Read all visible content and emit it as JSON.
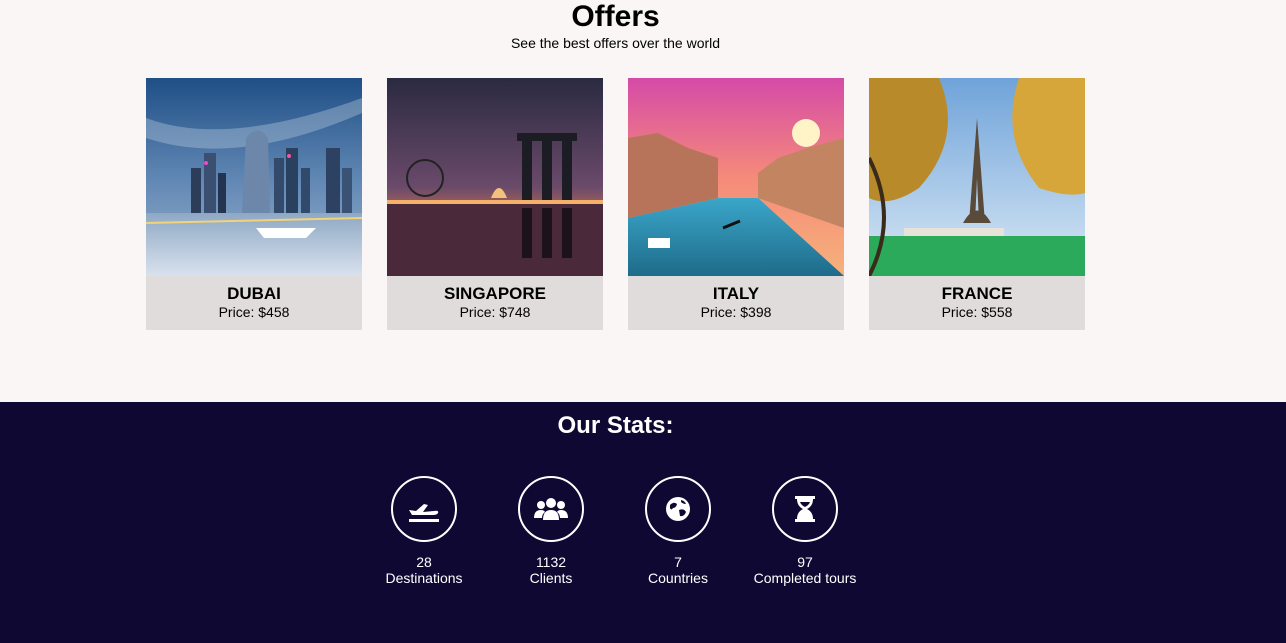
{
  "offers": {
    "title": "Offers",
    "subtitle": "See the best offers over the world",
    "price_prefix": "Price: ",
    "cards": [
      {
        "name": "DUBAI",
        "price": "Price: $458"
      },
      {
        "name": "SINGAPORE",
        "price": "Price: $748"
      },
      {
        "name": "ITALY",
        "price": "Price: $398"
      },
      {
        "name": "FRANCE",
        "price": "Price: $558"
      }
    ]
  },
  "stats": {
    "title": "Our Stats:",
    "items": [
      {
        "value": "28",
        "label": "Destinations",
        "icon": "plane-departure-icon"
      },
      {
        "value": "1132",
        "label": "Clients",
        "icon": "users-icon"
      },
      {
        "value": "7",
        "label": "Countries",
        "icon": "globe-icon"
      },
      {
        "value": "97",
        "label": "Completed tours",
        "icon": "hourglass-icon"
      }
    ]
  },
  "colors": {
    "page_bg": "#f9f6f5",
    "card_bg": "#dfdcdb",
    "stats_bg": "#0f0832",
    "stats_text": "#ffffff"
  }
}
